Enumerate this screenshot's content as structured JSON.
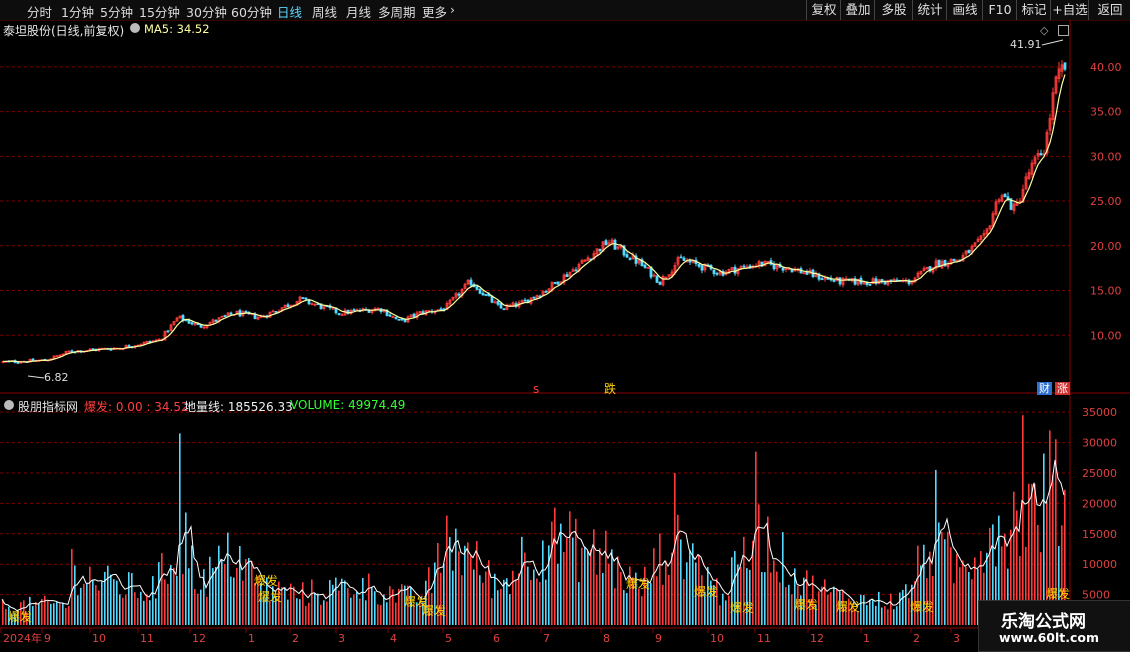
{
  "toolbar": {
    "periods": [
      "分时",
      "1分钟",
      "5分钟",
      "15分钟",
      "30分钟",
      "60分钟",
      "日线",
      "周线",
      "月线",
      "多周期",
      "更多"
    ],
    "active_period": "日线",
    "more_chevron": "›",
    "buttons": [
      "复权",
      "叠加",
      "多股",
      "统计",
      "画线",
      "F10",
      "标记",
      "+自选",
      "返回"
    ]
  },
  "price_panel": {
    "title": "泰坦股份(日线,前复权)",
    "ma_label": "MA5: 34.52",
    "high_label": "41.91",
    "low_label": "6.82",
    "y_ticks": [
      "40.00",
      "35.00",
      "30.00",
      "25.00",
      "20.00",
      "15.00",
      "10.00"
    ],
    "markers": {
      "s": "s",
      "fall": "跌"
    },
    "badges": {
      "fin": "财",
      "limit": "涨"
    }
  },
  "indicator_panel": {
    "title": "股朋指标网",
    "burst_label": "爆发: 0.00 : 34.52",
    "ground_label": "地量线: 185526.33",
    "volume_label": "VOLUME: 49974.49",
    "y_ticks": [
      "35000",
      "30000",
      "25000",
      "20000",
      "15000",
      "10000",
      "5000"
    ],
    "burst_tag": "爆发"
  },
  "x_axis": {
    "labels": [
      "2024年",
      "9",
      "10",
      "11",
      "12",
      "1",
      "2",
      "3",
      "4",
      "5",
      "6",
      "7",
      "8",
      "9",
      "10",
      "11",
      "12",
      "1",
      "2",
      "3"
    ]
  },
  "watermark": {
    "line1": "乐淘公式网",
    "line2": "www.60lt.com"
  },
  "colors": {
    "up": "#ff3b3b",
    "down": "#54d9ff",
    "ma": "#ffffa0",
    "grid": "#7a0000",
    "volume_line": "#ffffff",
    "active": "#5fd6ff",
    "burst": "#ffd400",
    "badge_fin": "#3070d0",
    "badge_limit": "#d03030"
  },
  "chart_data": {
    "type": "candlestick",
    "title": "泰坦股份(日线,前复权)",
    "price_ylim": [
      5,
      43
    ],
    "volume_ylim": [
      0,
      37000
    ],
    "x_months": [
      "2024-08",
      "2024-09",
      "2024-10",
      "2024-11",
      "2024-12",
      "2025-01",
      "2025-02",
      "2025-03",
      "2025-04",
      "2025-05",
      "2025-06",
      "2025-07",
      "2025-08",
      "2025-09",
      "2025-10",
      "2025-11",
      "2025-12",
      "2026-01",
      "2026-02",
      "2026-03"
    ],
    "price_anchors": [
      [
        0,
        7.0
      ],
      [
        45,
        7.2
      ],
      [
        70,
        8.2
      ],
      [
        120,
        8.6
      ],
      [
        160,
        9.5
      ],
      [
        178,
        12.0
      ],
      [
        200,
        11.0
      ],
      [
        235,
        12.5
      ],
      [
        260,
        12.0
      ],
      [
        300,
        14.0
      ],
      [
        340,
        12.5
      ],
      [
        380,
        13.0
      ],
      [
        400,
        11.5
      ],
      [
        420,
        12.5
      ],
      [
        445,
        13.0
      ],
      [
        470,
        16.0
      ],
      [
        500,
        13.0
      ],
      [
        520,
        13.5
      ],
      [
        545,
        15.0
      ],
      [
        575,
        17.5
      ],
      [
        608,
        20.5
      ],
      [
        640,
        18.0
      ],
      [
        660,
        16.0
      ],
      [
        680,
        18.5
      ],
      [
        720,
        17.0
      ],
      [
        760,
        18.0
      ],
      [
        790,
        17.5
      ],
      [
        820,
        16.5
      ],
      [
        840,
        16.0
      ],
      [
        880,
        16.0
      ],
      [
        910,
        16.0
      ],
      [
        935,
        18.0
      ],
      [
        960,
        18.5
      ],
      [
        985,
        21.0
      ],
      [
        1000,
        26.0
      ],
      [
        1015,
        24.0
      ],
      [
        1030,
        28.5
      ],
      [
        1045,
        31.0
      ],
      [
        1055,
        38.0
      ],
      [
        1063,
        40.0
      ]
    ],
    "price_high": 41.91,
    "price_low": 6.82,
    "ma5_last": 34.52,
    "volume_anchors": [
      [
        0,
        3000
      ],
      [
        68,
        3500
      ],
      [
        75,
        9000
      ],
      [
        100,
        7000
      ],
      [
        150,
        5500
      ],
      [
        180,
        13000
      ],
      [
        200,
        7000
      ],
      [
        235,
        12000
      ],
      [
        260,
        6000
      ],
      [
        300,
        5000
      ],
      [
        360,
        6500
      ],
      [
        420,
        4000
      ],
      [
        450,
        14000
      ],
      [
        500,
        6000
      ],
      [
        520,
        11000
      ],
      [
        555,
        14000
      ],
      [
        600,
        11000
      ],
      [
        640,
        6000
      ],
      [
        675,
        15000
      ],
      [
        720,
        5000
      ],
      [
        760,
        15000
      ],
      [
        800,
        7000
      ],
      [
        850,
        4000
      ],
      [
        900,
        4000
      ],
      [
        930,
        13000
      ],
      [
        960,
        9000
      ],
      [
        990,
        16000
      ],
      [
        1010,
        17000
      ],
      [
        1030,
        19000
      ],
      [
        1063,
        22000
      ]
    ],
    "volume_spikes": [
      [
        72,
        12500
      ],
      [
        178,
        31500
      ],
      [
        185,
        18500
      ],
      [
        447,
        18000
      ],
      [
        552,
        17000
      ],
      [
        605,
        15500
      ],
      [
        673,
        25000
      ],
      [
        755,
        28500
      ],
      [
        935,
        25500
      ],
      [
        1022,
        34500
      ],
      [
        1050,
        32000
      ]
    ],
    "volume_last": 49974.49,
    "ground_line": 185526.33,
    "burst_value": 0.0
  }
}
